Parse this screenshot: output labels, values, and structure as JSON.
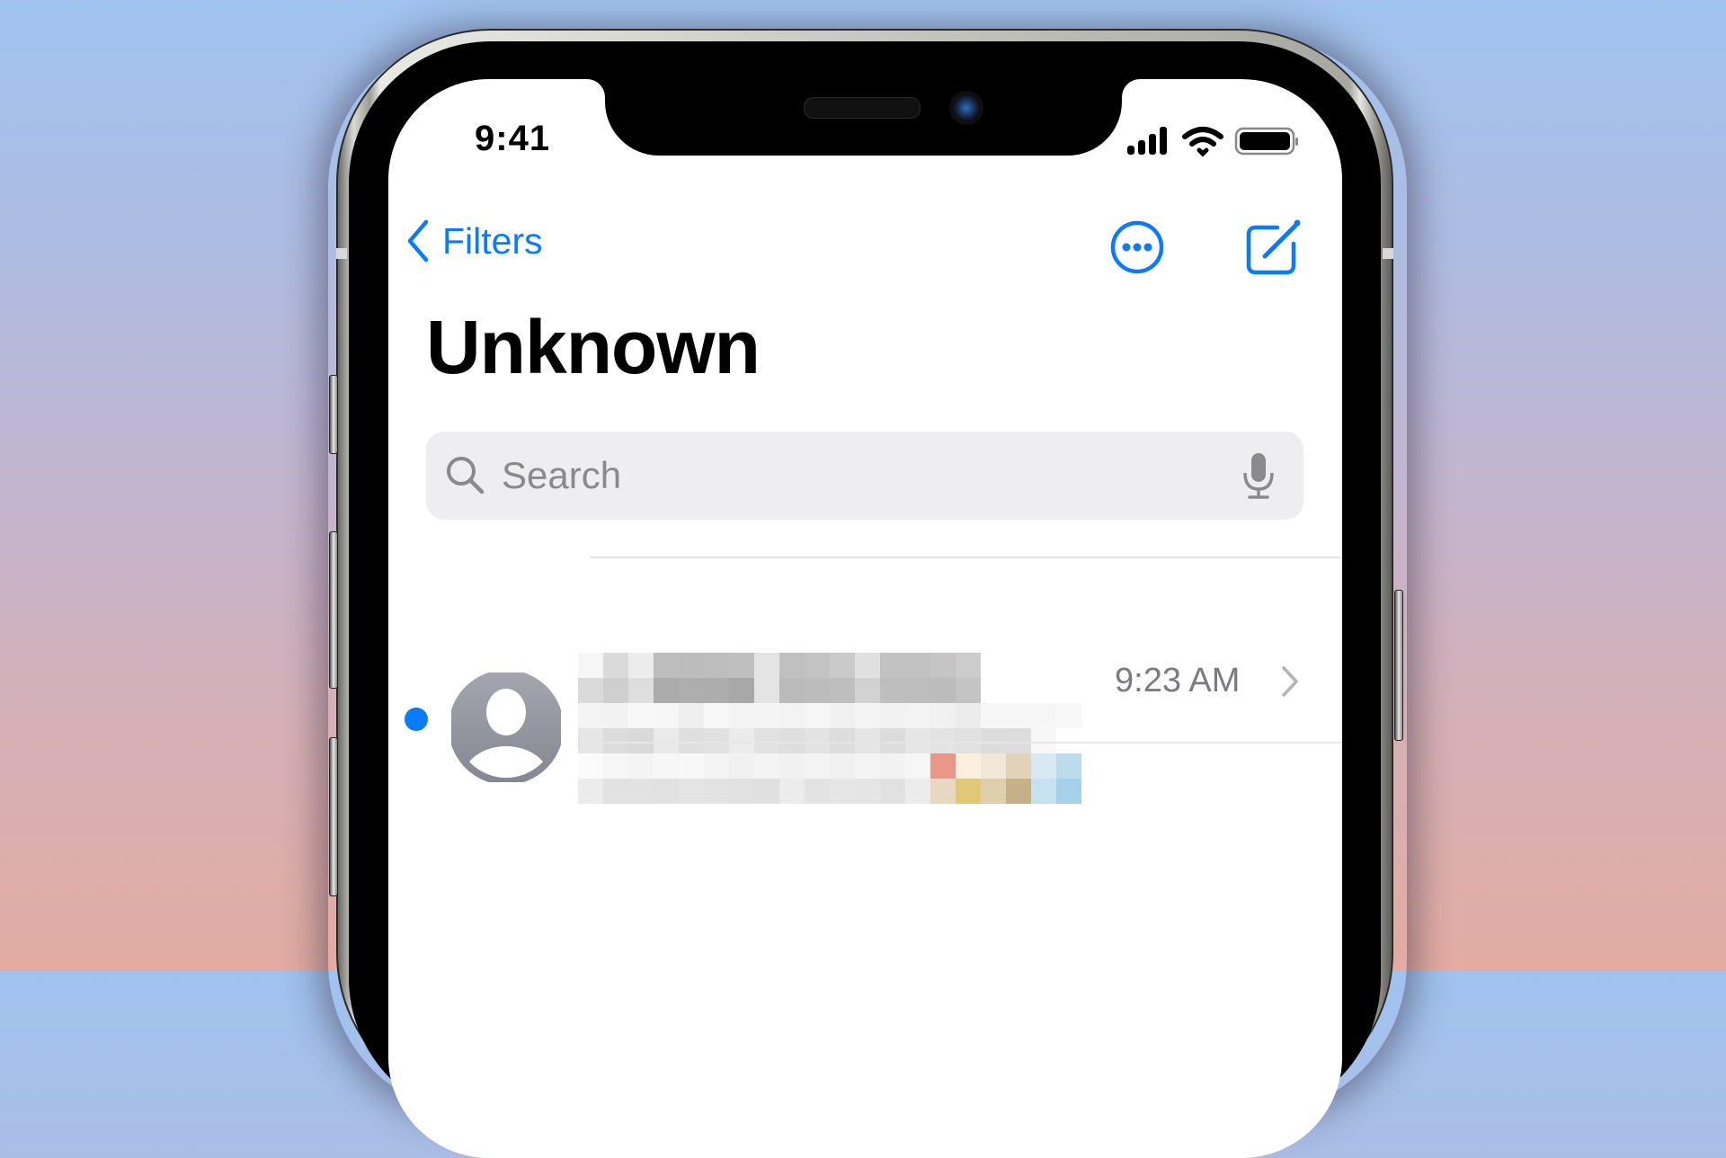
{
  "status_bar": {
    "time": "9:41",
    "icons": [
      "cellular-signal-icon",
      "wifi-icon",
      "battery-icon"
    ]
  },
  "nav": {
    "back_label": "Filters",
    "back_icon": "chevron-left-icon",
    "more_icon": "ellipsis-circle-icon",
    "compose_icon": "compose-icon"
  },
  "page": {
    "title": "Unknown"
  },
  "search": {
    "placeholder": "Search",
    "value": "",
    "search_icon": "magnifying-glass-icon",
    "mic_icon": "microphone-icon"
  },
  "messages": [
    {
      "sender": "[redacted]",
      "preview": "[redacted]",
      "time": "9:23 AM",
      "unread": true,
      "avatar": "person-placeholder-icon"
    }
  ],
  "colors": {
    "accent": "#0a7aff",
    "secondary_text": "#7b7b80",
    "search_bg": "#eeeef0",
    "avatar_gray": "#8e9099"
  }
}
